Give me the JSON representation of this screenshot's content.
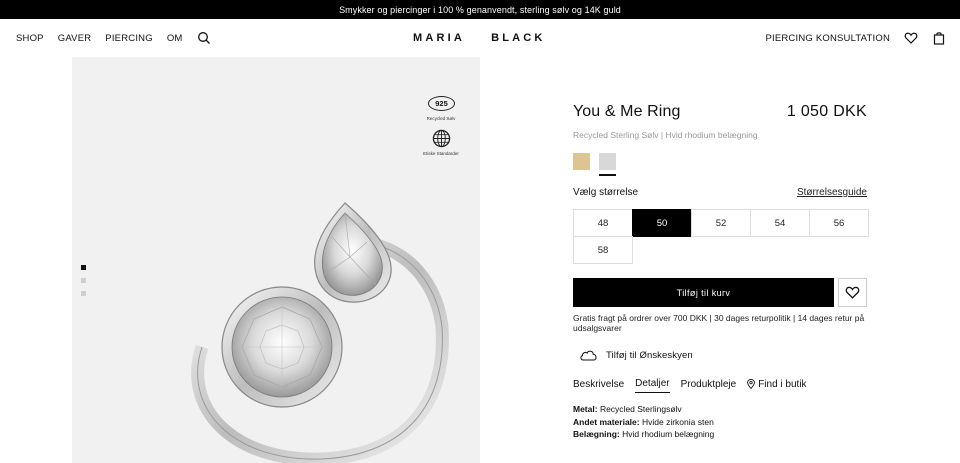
{
  "announcement": "Smykker og piercinger i 100 % genanvendt, sterling sølv og 14K guld",
  "nav": {
    "left": [
      "SHOP",
      "GAVER",
      "PIERCING",
      "OM"
    ],
    "right_link": "PIERCING KONSULTATION",
    "logo_left": "MARIA",
    "logo_right": "BLACK",
    "icons": [
      "search-icon",
      "heart-icon",
      "bag-icon"
    ]
  },
  "gallery": {
    "badge_925": "925",
    "badge_925_label": "Recycled Sølv",
    "badge_globe_label": "Etiske Standarder",
    "slides": 3,
    "active_slide": 1
  },
  "product": {
    "title": "You & Me Ring",
    "price": "1 050 DKK",
    "subtitle": "Recycled Sterling Sølv | Hvid rhodium belægning",
    "swatches": [
      {
        "name": "gold",
        "color": "#dcc593"
      },
      {
        "name": "silver",
        "color": "#d8d8d8",
        "selected": true
      }
    ],
    "size_label": "Vælg størrelse",
    "size_guide": "Størrelsesguide",
    "sizes": [
      "48",
      "50",
      "52",
      "54",
      "56",
      "58"
    ],
    "selected_size": "50",
    "add_to_cart": "Tilføj til kurv",
    "shipping": "Gratis fragt på ordrer over 700 DKK | 30 dages returpolitik | 14 dages retur på udsalgsvarer",
    "wishlist_cloud": "Tilføj til Ønskeskyen"
  },
  "tabs": [
    "Beskrivelse",
    "Detaljer",
    "Produktpleje",
    "Find i butik"
  ],
  "active_tab": "Detaljer",
  "details": [
    {
      "key": "Metal:",
      "value": "Recycled Sterlingsølv"
    },
    {
      "key": "Andet materiale:",
      "value": "Hvide zirkonia sten"
    },
    {
      "key": "Belægning:",
      "value": "Hvid rhodium belægning"
    }
  ],
  "colors": {
    "accent": "#000000",
    "muted": "#999999",
    "gallery_bg": "#f1f1f1"
  }
}
